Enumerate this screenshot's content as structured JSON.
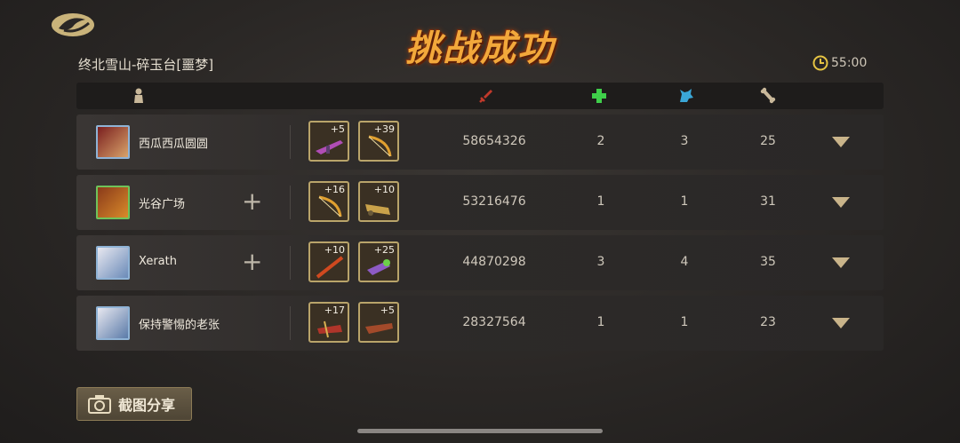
{
  "title": "挑战成功",
  "location": "终北雪山-碎玉台[噩梦]",
  "timer": "55:00",
  "share_label": "截图分享",
  "header_icons": [
    "player-icon",
    "sword-icon",
    "heal-cross-icon",
    "wolf-icon",
    "bone-icon"
  ],
  "players": [
    {
      "name": "西瓜西瓜圆圆",
      "has_add": false,
      "w1": "+5",
      "w2": "+39",
      "damage": "58654326",
      "c1": "2",
      "c2": "3",
      "c3": "25"
    },
    {
      "name": "光谷广场",
      "has_add": true,
      "w1": "+16",
      "w2": "+10",
      "damage": "53216476",
      "c1": "1",
      "c2": "1",
      "c3": "31"
    },
    {
      "name": "Xerath",
      "has_add": true,
      "w1": "+10",
      "w2": "+25",
      "damage": "44870298",
      "c1": "3",
      "c2": "4",
      "c3": "35"
    },
    {
      "name": "保持警惕的老张",
      "has_add": false,
      "w1": "+17",
      "w2": "+5",
      "damage": "28327564",
      "c1": "1",
      "c2": "1",
      "c3": "23"
    }
  ],
  "colors": {
    "accent": "#f2a83b",
    "frame": "#b9a46a",
    "heal": "#3fcf4a",
    "wolf": "#3aa6d6",
    "sword": "#c0392b"
  }
}
